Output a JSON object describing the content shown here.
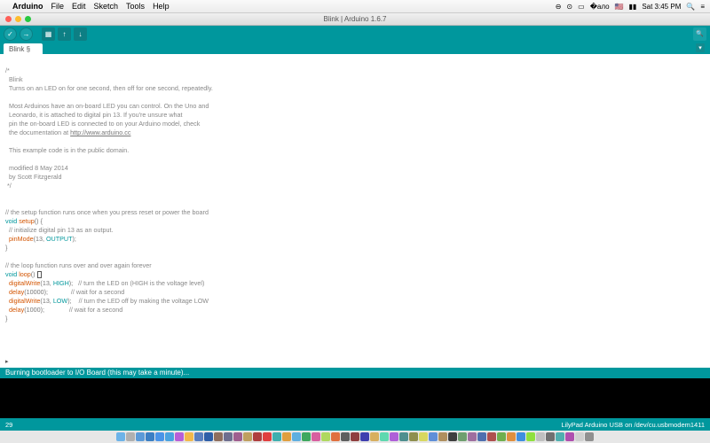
{
  "menubar": {
    "app": "Arduino",
    "items": [
      "File",
      "Edit",
      "Sketch",
      "Tools",
      "Help"
    ],
    "clock": "Sat 3:45 PM"
  },
  "window": {
    "title": "Blink | Arduino 1.6.7"
  },
  "tab": {
    "name": "Blink §"
  },
  "code": {
    "c1": "/*",
    "c2": "  Blink",
    "c3": "  Turns on an LED on for one second, then off for one second, repeatedly.",
    "c4": "  Most Arduinos have an on-board LED you can control. On the Uno and",
    "c5": "  Leonardo, it is attached to digital pin 13. If you're unsure what",
    "c6": "  pin the on-board LED is connected to on your Arduino model, check",
    "c7a": "  the documentation at ",
    "c7b": "http://www.arduino.cc",
    "c8": "  This example code is in the public domain.",
    "c9": "  modified 8 May 2014",
    "c10": "  by Scott Fitzgerald",
    "c11": " */",
    "s1": "// the setup function runs once when you press reset or power the board",
    "kw_void1": "void ",
    "fn_setup": "setup",
    "s2": "() {",
    "s3": "  // initialize digital pin 13 as an output.",
    "fn_pinmode": "  pinMode",
    "s4": "(13, ",
    "cn_output": "OUTPUT",
    "s5": ");",
    "brace1": "}",
    "l1": "// the loop function runs over and over again forever",
    "kw_void2": "void ",
    "fn_loop": "loop",
    "l2": "() ",
    "fn_dw1": "  digitalWrite",
    "l3a": "(13, ",
    "cn_high": "HIGH",
    "l3b": ");   ",
    "l3c": "// turn the LED on (HIGH is the voltage level)",
    "fn_delay1": "  delay",
    "l4a": "(10000);             ",
    "l4b": "// wait for a second",
    "fn_dw2": "  digitalWrite",
    "l5a": "(13, ",
    "cn_low": "LOW",
    "l5b": ");    ",
    "l5c": "// turn the LED off by making the voltage LOW",
    "fn_delay2": "  delay",
    "l6a": "(1000);              ",
    "l6b": "// wait for a second",
    "brace2": "}"
  },
  "status": {
    "msg": "Burning bootloader to I/O Board (this may take a minute)...",
    "line": "29",
    "board": "LilyPad Arduino USB on /dev/cu.usbmodem1411"
  },
  "dock_colors": [
    "#6db3e8",
    "#b0b0b0",
    "#5b9ad8",
    "#3b7fc4",
    "#4a94e8",
    "#4aa3e0",
    "#b85fd8",
    "#f2b84a",
    "#5a7fbf",
    "#2f5fa8",
    "#8f6f5f",
    "#6f6f8f",
    "#9f5f8f",
    "#bf9f5f",
    "#af3f3f",
    "#e03f3f",
    "#3fafaf",
    "#e09f3f",
    "#5fafe0",
    "#3fa85f",
    "#d85f9f",
    "#afd85f",
    "#e0703f",
    "#5f5f5f",
    "#8f3f3f",
    "#3f3faf",
    "#d8af5f",
    "#5fd8af",
    "#af5fd8",
    "#4f8f8f",
    "#8f8f4f",
    "#d8d85f",
    "#5f8fd8",
    "#af8f5f",
    "#3f3f3f",
    "#6f9f6f",
    "#9f6f9f",
    "#4f6faf",
    "#af4f4f",
    "#6faf4f",
    "#e08f3f",
    "#3f8fe0",
    "#8fe03f",
    "#c0c0c0",
    "#707070",
    "#4fafaf",
    "#af4faf",
    "#d0d0d0",
    "#909090"
  ]
}
